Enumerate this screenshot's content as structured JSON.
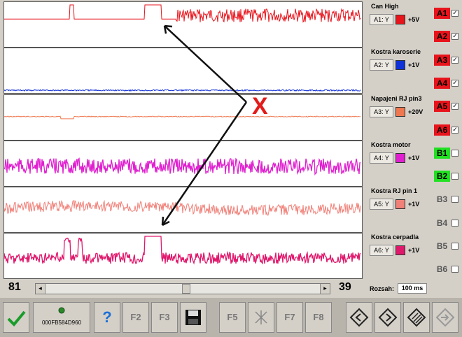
{
  "channels": [
    {
      "name": "Can High",
      "btn": "A1: Y",
      "color": "#e8141c",
      "volts": "+5V"
    },
    {
      "name": "Kostra karoserie",
      "btn": "A2: Y",
      "color": "#1030d8",
      "volts": "+1V"
    },
    {
      "name": "Napajeni RJ pin3",
      "btn": "A3: Y",
      "color": "#f07850",
      "volts": "+20V"
    },
    {
      "name": "Kostra motor",
      "btn": "A4: Y",
      "color": "#e020d0",
      "volts": "+1V"
    },
    {
      "name": "Kostra RJ pin 1",
      "btn": "A5: Y",
      "color": "#f08078",
      "volts": "+1V"
    },
    {
      "name": "Kostra cerpadla",
      "btn": "A6: Y",
      "color": "#e0186c",
      "volts": "+1V"
    }
  ],
  "checks": [
    {
      "label": "A1",
      "checked": true,
      "color": "#e8141c"
    },
    {
      "label": "A2",
      "checked": true,
      "color": "#e8141c"
    },
    {
      "label": "A3",
      "checked": true,
      "color": "#e8141c"
    },
    {
      "label": "A4",
      "checked": true,
      "color": "#e8141c"
    },
    {
      "label": "A5",
      "checked": true,
      "color": "#e8141c"
    },
    {
      "label": "A6",
      "checked": true,
      "color": "#e8141c"
    },
    {
      "label": "B1",
      "checked": false,
      "color": "#22e022"
    },
    {
      "label": "B2",
      "checked": false,
      "color": "#22e022"
    },
    {
      "label": "B3",
      "checked": false,
      "color": ""
    },
    {
      "label": "B4",
      "checked": false,
      "color": ""
    },
    {
      "label": "B5",
      "checked": false,
      "color": ""
    },
    {
      "label": "B6",
      "checked": false,
      "color": ""
    }
  ],
  "bottom": {
    "left_number": "81",
    "right_number": "39",
    "scroll_position": 0.51
  },
  "rozsah": {
    "label": "Rozsah:",
    "value": "100 ms"
  },
  "annotation": {
    "mark": "X",
    "color": "#e31b1b"
  },
  "toolbar": {
    "device_id": "000FB584D960",
    "help": "?",
    "f2": "F2",
    "f3": "F3",
    "f5": "F5",
    "f7": "F7",
    "f8": "F8"
  }
}
